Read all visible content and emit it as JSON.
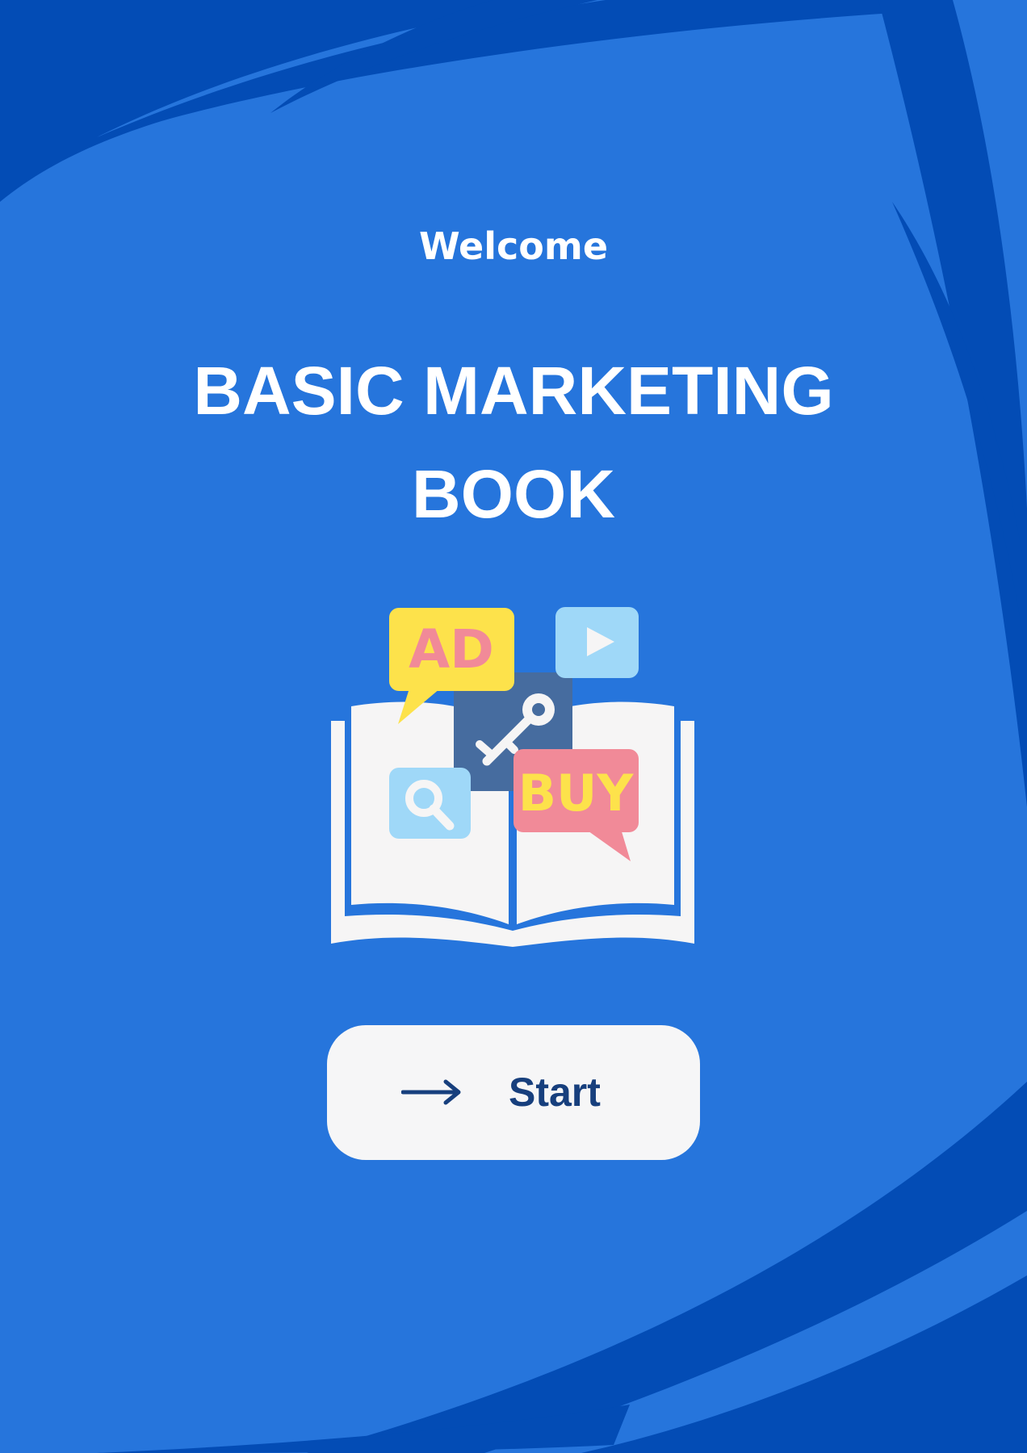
{
  "welcome_text": "Welcome",
  "title_line1": "BASIC MARKETING",
  "title_line2": "BOOK",
  "illustration": {
    "ad_label": "AD",
    "buy_label": "BUY",
    "icons": [
      "open-book-icon",
      "ad-speech-bubble-icon",
      "play-icon",
      "key-icon",
      "search-icon",
      "buy-speech-bubble-icon"
    ]
  },
  "start_button": {
    "label": "Start",
    "icon": "arrow-right-icon"
  },
  "colors": {
    "background": "#2675dc",
    "background_swoosh": "#034cb5",
    "button_bg": "#f6f6f7",
    "button_text": "#173f7d",
    "ad_bubble": "#fde24b",
    "ad_text": "#f18a98",
    "buy_bubble": "#f18a98",
    "buy_text": "#fde24b",
    "light_blue_icon": "#9fd8f8",
    "key_square": "#466c9f",
    "book_page": "#f6f5f5"
  }
}
